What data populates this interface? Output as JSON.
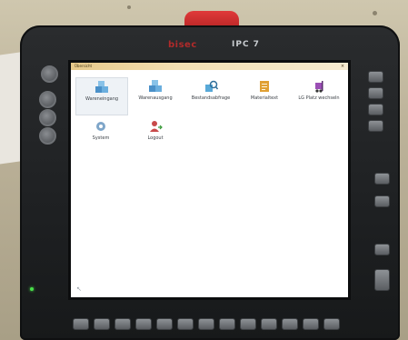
{
  "device": {
    "brand": "bisec",
    "model": "IPC 7"
  },
  "app": {
    "window_title": "Übersicht",
    "close_glyph": "×"
  },
  "menu": {
    "items": [
      {
        "label": "Wareneingang",
        "icon": "boxes-icon",
        "color": "#4a90c8",
        "selected": true
      },
      {
        "label": "Warenausgang",
        "icon": "boxes-icon",
        "color": "#4a90c8"
      },
      {
        "label": "Bestandsabfrage",
        "icon": "search-boxes-icon",
        "color": "#58a9d8"
      },
      {
        "label": "Materialtext",
        "icon": "document-icon",
        "color": "#e0a034"
      },
      {
        "label": "LG Platz wechseln",
        "icon": "forklift-icon",
        "color": "#9b4fb5"
      },
      {
        "label": "System",
        "icon": "gear-icon",
        "color": "#7fa6c9"
      },
      {
        "label": "Logout",
        "icon": "user-logout-icon",
        "color": "#c84a4a"
      }
    ]
  },
  "colors": {
    "screen_bg": "#ffffff",
    "titlebar": "#f2dfb3",
    "handle": "#d32f2f",
    "led": "#49e04a"
  }
}
